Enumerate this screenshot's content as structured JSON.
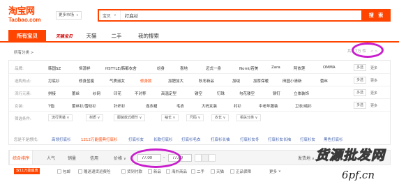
{
  "logo": {
    "cn": "淘宝网",
    "en": "Taobao.com"
  },
  "market": {
    "label": "更多市场"
  },
  "search": {
    "scope": "宝贝",
    "query": "打底衫",
    "button": "搜 索"
  },
  "tabs": [
    {
      "label": "所有宝贝"
    },
    {
      "label": "天猫"
    },
    {
      "label": "二手"
    },
    {
      "label": "我的搜索"
    }
  ],
  "tmall_logo": "天猫宝贝",
  "crumb": "所有分类 >",
  "result_count": "共1.7万 件",
  "pager": "< >",
  "rows": {
    "brand": {
      "label": "品牌:",
      "items": [
        "韩国SZ",
        "恒源祥",
        "HSTYLE/韩都衣舍",
        "纷身",
        "喜地",
        "迈式一身",
        "Nomi/若美",
        "Zara",
        "阿依莲",
        "OMMA"
      ],
      "multi": "多选",
      "more": "更多"
    },
    "hot": {
      "label": "选购热点:",
      "items": [
        "打底衫",
        "修身显瘦",
        "气质淑女",
        "修身款",
        "加肥加大",
        "秋冬新品",
        "加绒",
        "加厚保暖",
        "田园小清新",
        "蕾丝"
      ],
      "multi": "多选",
      "more": "更多"
    },
    "element": {
      "label": "流行元素:",
      "items": [
        "拼接",
        "蕾丝",
        "纱网",
        "印花",
        "不对称",
        "高温定型",
        "镂空",
        "钉珠",
        "勾花镂空",
        "铆钉",
        "立体装饰"
      ],
      "multi": "多选",
      "more": "更多"
    },
    "women": {
      "label": "女装:",
      "items": [
        "T恤",
        "蕾丝衫/雪纺衫",
        "针织衫",
        "连衣裙",
        "毛衣",
        "大码女装",
        "衬衫",
        "中老年服装",
        "卫衣/绒衫"
      ],
      "multi": "多选",
      "more": "更多"
    },
    "filter": {
      "label": "筛选条件:",
      "dropdowns": [
        "流行男装",
        "材质",
        "服装款式细节",
        "袖长",
        "尺码",
        "衣长",
        "相关分类"
      ]
    }
  },
  "tips": {
    "label": "您是不是想找:",
    "items": [
      "高领打底衫",
      "1212万能盛典打底衫",
      "打底衫女",
      "长款打底衫",
      "打底衫毛衣",
      "打底衫长袖",
      "打底衫女冬",
      "打底衫女长袖",
      "打底衫女",
      "黑色打底衫"
    ]
  },
  "sort": {
    "items": [
      "综合排序",
      "人气",
      "销量",
      "信用",
      "价格"
    ],
    "price_min": "77.00",
    "price_max": "77.00",
    "price_sep": "-",
    "ship_from": "发货地"
  },
  "checks": {
    "badge": "双11万能盛典",
    "items": [
      "包邮",
      "赠送退货运费险",
      "货到付款",
      "新品",
      "海外商品",
      "二手",
      "天猫",
      "正品保障",
      "更多"
    ]
  },
  "watermark": {
    "cn": "货源批发网",
    "url": "6pf.cn"
  },
  "colors": {
    "accent": "#ff4400",
    "highlight_circle": "#c81ecc",
    "link": "#3c5cab"
  }
}
